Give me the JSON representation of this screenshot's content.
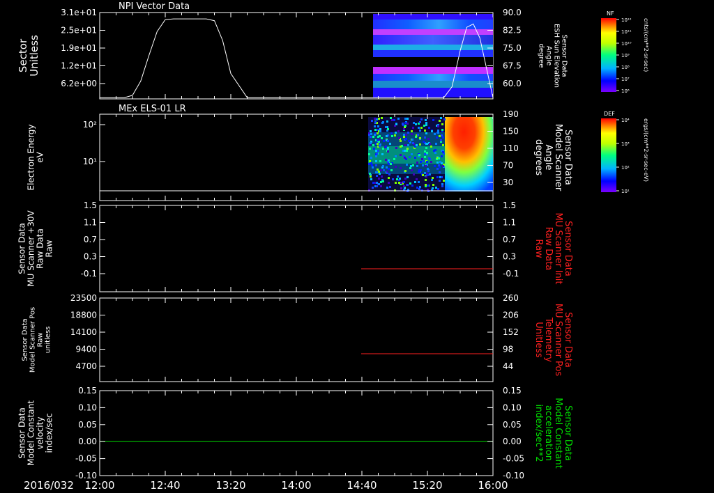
{
  "date_label": "2016/032",
  "x_ticks": [
    "12:00",
    "12:40",
    "13:20",
    "14:00",
    "14:40",
    "15:20",
    "16:00"
  ],
  "panels": [
    {
      "title": "NPI Vector Data",
      "left_label": [
        "Sector",
        "Unitless"
      ],
      "left_ticks": [
        "3.1e+01",
        "2.5e+01",
        "1.9e+01",
        "1.2e+01",
        "6.2e+00"
      ],
      "right_label": [
        "Sensor Data",
        "ESH Sun Elevation",
        "Angle",
        "degree"
      ],
      "right_ticks": [
        "90.0",
        "82.5",
        "75.0",
        "67.5",
        "60.0"
      ],
      "colorbar_title": "NF",
      "colorbar_ticks": [
        "10¹²",
        "10¹¹",
        "10¹⁰",
        "10⁹",
        "10⁸",
        "10⁷",
        "10⁶"
      ],
      "colorbar_units": "cnts/(cm**2-sr-sec)"
    },
    {
      "title": "MEx ELS-01 LR",
      "left_label": [
        "Electron Energy",
        "eV"
      ],
      "left_ticks": [
        "10²",
        "10¹"
      ],
      "right_label": [
        "Sensor Data",
        "Model Scanner",
        "Angle",
        "degrees"
      ],
      "right_ticks": [
        "190",
        "150",
        "110",
        "70",
        "30"
      ],
      "colorbar_title": "DEF",
      "colorbar_ticks": [
        "10⁴",
        "10³",
        "10²",
        "10¹"
      ],
      "colorbar_units": "ergs/(cm**2-sr-sec-eV)"
    },
    {
      "left_label": [
        "Sensor Data",
        "MU Scanner +30V",
        "Raw Data",
        "Raw"
      ],
      "left_ticks": [
        "1.5",
        "1.1",
        "0.7",
        "0.3",
        "-0.1"
      ],
      "right_label": [
        "Sensor Data",
        "MU Scanner Init",
        "Raw Data",
        "Raw"
      ],
      "right_ticks": [
        "1.5",
        "1.1",
        "0.7",
        "0.3",
        "-0.1"
      ]
    },
    {
      "left_label": [
        "Sensor Data",
        "Model Scanner Pos",
        "Raw",
        "unitless"
      ],
      "left_ticks": [
        "23500",
        "18800",
        "14100",
        "9400",
        "4700"
      ],
      "right_label": [
        "Sensor Data",
        "MU Scanner Pos",
        "Telemetry",
        "Unitless"
      ],
      "right_ticks": [
        "260",
        "206",
        "152",
        "98",
        "44"
      ]
    },
    {
      "left_label": [
        "Sensor Data",
        "Model Constant",
        "velocity",
        "index/sec"
      ],
      "left_ticks": [
        "0.15",
        "0.10",
        "0.05",
        "0.00",
        "-0.05",
        "-0.10"
      ],
      "right_label": [
        "Sensor Data",
        "Model Constant",
        "acceleration",
        "index/sec**2"
      ],
      "right_ticks": [
        "0.15",
        "0.10",
        "0.05",
        "0.00",
        "-0.05",
        "-0.10"
      ]
    }
  ],
  "colors": {
    "background": "#000000",
    "axes": "#ffffff",
    "red_series": "#ff2020",
    "green_series": "#00e000"
  },
  "chart_data": [
    {
      "type": "line",
      "title": "NPI Vector Data",
      "xlim": [
        "12:00",
        "16:00"
      ],
      "ylim_right": [
        56,
        90
      ],
      "series": [
        {
          "axis": "right",
          "x": [
            "12:00",
            "12:15",
            "12:20",
            "12:25",
            "12:30",
            "12:35",
            "12:40",
            "12:45",
            "13:05",
            "13:10",
            "13:15",
            "13:20",
            "13:30",
            "15:30",
            "15:35",
            "15:40",
            "15:44",
            "15:48",
            "15:52",
            "16:00"
          ],
          "y": [
            56.5,
            56.5,
            57.4,
            63.0,
            73.0,
            82.5,
            87.2,
            87.5,
            87.5,
            86.8,
            79.0,
            66.0,
            56.5,
            56.5,
            60.8,
            75.0,
            84.2,
            85.5,
            80.0,
            56.5
          ]
        }
      ],
      "heatmap": {
        "x_range": [
          "14:42",
          "16:00"
        ]
      }
    },
    {
      "type": "heatmap",
      "title": "MEx ELS-01 LR",
      "xlim": [
        "12:00",
        "16:00"
      ],
      "y_scale": "log",
      "x_range": [
        "14:40",
        "16:00"
      ],
      "hot_region": {
        "x_range": [
          "15:35",
          "16:00"
        ],
        "energy_ev": [
          40,
          200
        ]
      },
      "series": [
        {
          "axis": "right",
          "x": [
            "12:00",
            "16:00"
          ],
          "y": [
            10,
            10
          ]
        }
      ],
      "ylim_right": [
        0,
        190
      ]
    },
    {
      "type": "line",
      "xlim": [
        "12:00",
        "16:00"
      ],
      "ylim": [
        -0.3,
        1.5
      ],
      "series": [
        {
          "axis": "right",
          "color": "#ff2020",
          "x": [
            "14:40",
            "16:00"
          ],
          "y": [
            0.0,
            0.0
          ]
        }
      ]
    },
    {
      "type": "line",
      "xlim": [
        "12:00",
        "16:00"
      ],
      "ylim_right": [
        0,
        260
      ],
      "series": [
        {
          "axis": "right",
          "color": "#ff2020",
          "x": [
            "14:40",
            "16:00"
          ],
          "y": [
            80,
            80
          ]
        }
      ]
    },
    {
      "type": "line",
      "xlim": [
        "12:00",
        "16:00"
      ],
      "ylim": [
        -0.1,
        0.15
      ],
      "series": [
        {
          "axis": "left",
          "color": "#00e000",
          "x": [
            "12:00",
            "16:00"
          ],
          "y": [
            0.0,
            0.0
          ]
        }
      ]
    }
  ]
}
